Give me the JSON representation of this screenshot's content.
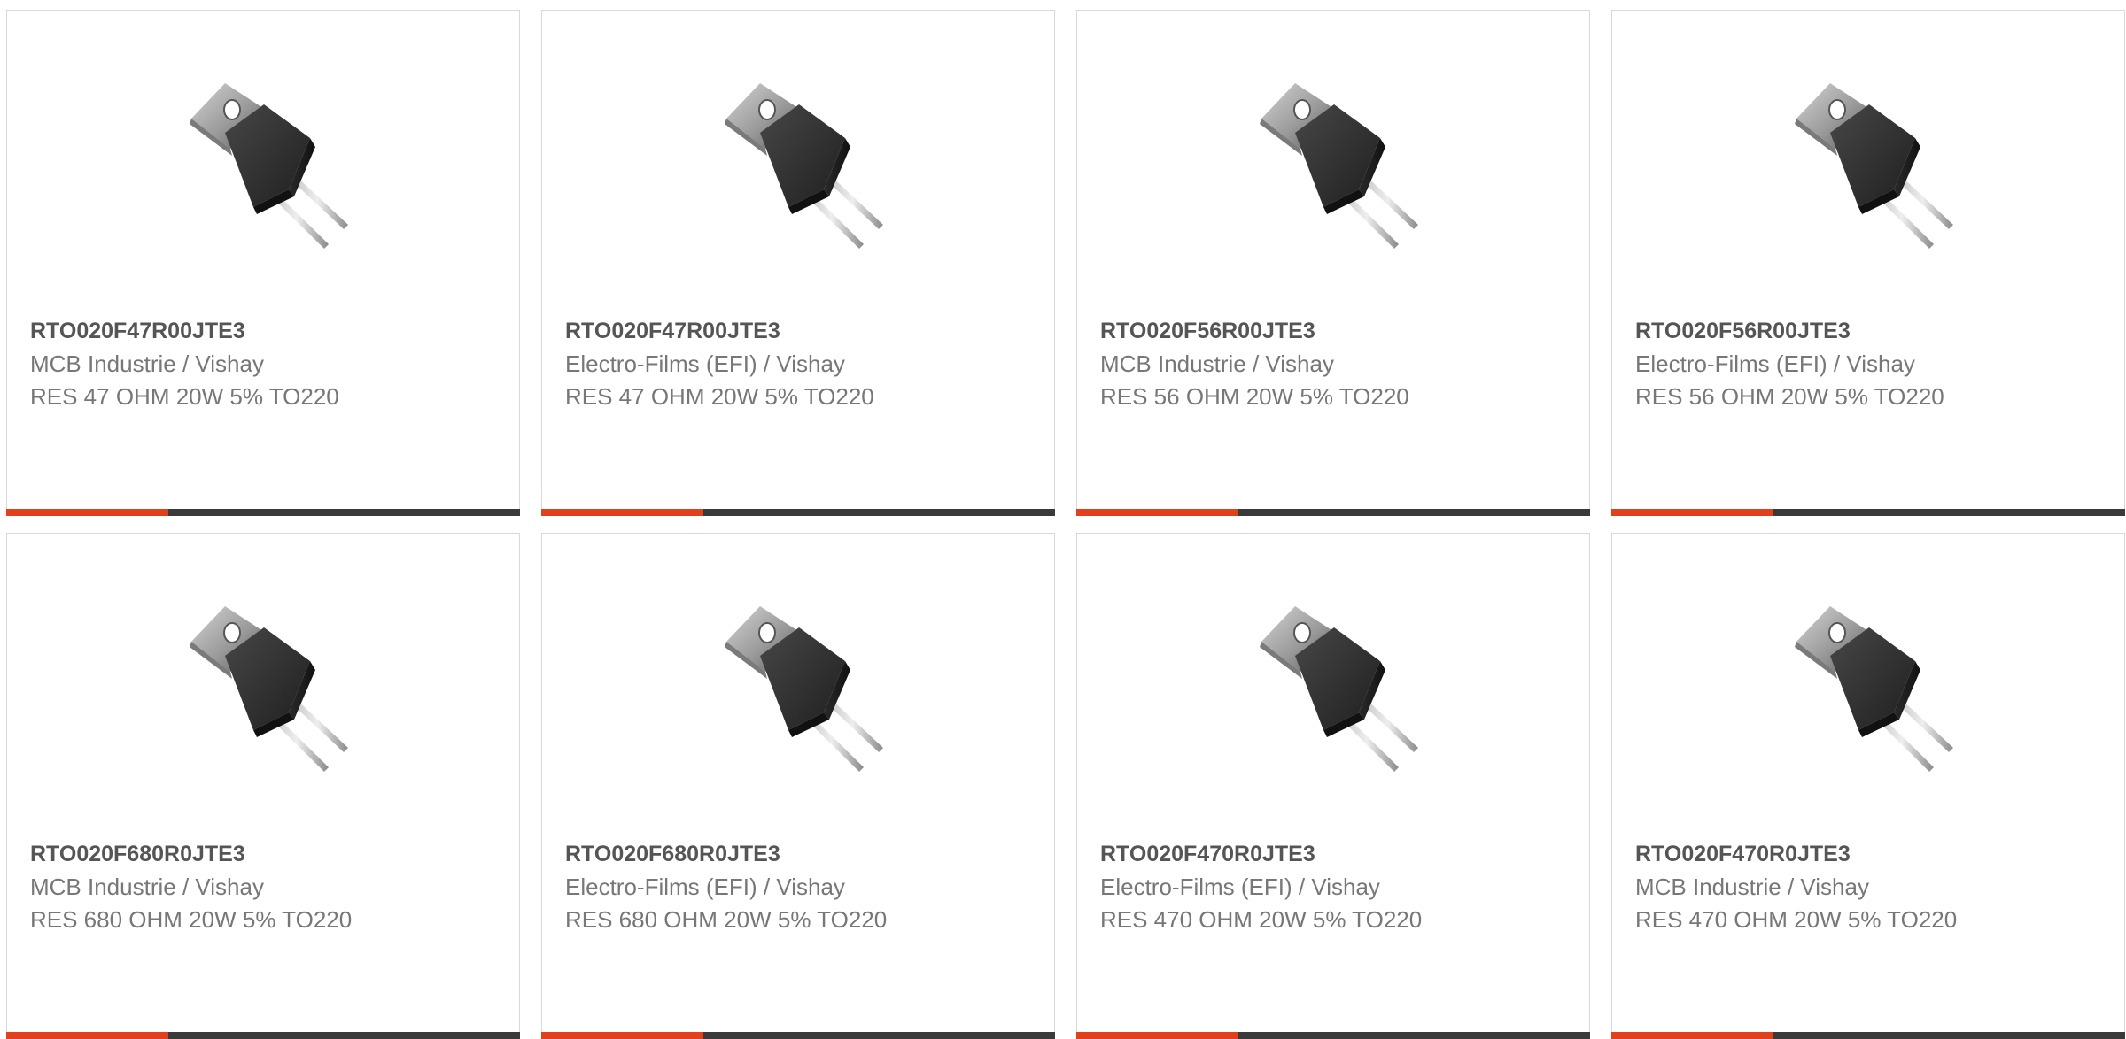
{
  "colors": {
    "accent": "#e2401c",
    "bar": "#3a3a3a",
    "part_number": "#555555",
    "body_text": "#777777",
    "border": "#d9d9d9"
  },
  "products": [
    {
      "image_icon": "to220-resistor-image",
      "part_number": "RTO020F47R00JTE3",
      "manufacturer": "MCB Industrie / Vishay",
      "description": "RES 47 OHM 20W 5% TO220"
    },
    {
      "image_icon": "to220-resistor-image",
      "part_number": "RTO020F47R00JTE3",
      "manufacturer": "Electro-Films (EFI) / Vishay",
      "description": "RES 47 OHM 20W 5% TO220"
    },
    {
      "image_icon": "to220-resistor-image",
      "part_number": "RTO020F56R00JTE3",
      "manufacturer": "MCB Industrie / Vishay",
      "description": "RES 56 OHM 20W 5% TO220"
    },
    {
      "image_icon": "to220-resistor-image",
      "part_number": "RTO020F56R00JTE3",
      "manufacturer": "Electro-Films (EFI) / Vishay",
      "description": "RES 56 OHM 20W 5% TO220"
    },
    {
      "image_icon": "to220-resistor-image",
      "part_number": "RTO020F680R0JTE3",
      "manufacturer": "MCB Industrie / Vishay",
      "description": "RES 680 OHM 20W 5% TO220"
    },
    {
      "image_icon": "to220-resistor-image",
      "part_number": "RTO020F680R0JTE3",
      "manufacturer": "Electro-Films (EFI) / Vishay",
      "description": "RES 680 OHM 20W 5% TO220"
    },
    {
      "image_icon": "to220-resistor-image",
      "part_number": "RTO020F470R0JTE3",
      "manufacturer": "Electro-Films (EFI) / Vishay",
      "description": "RES 470 OHM 20W 5% TO220"
    },
    {
      "image_icon": "to220-resistor-image",
      "part_number": "RTO020F470R0JTE3",
      "manufacturer": "MCB Industrie / Vishay",
      "description": "RES 470 OHM 20W 5% TO220"
    }
  ]
}
